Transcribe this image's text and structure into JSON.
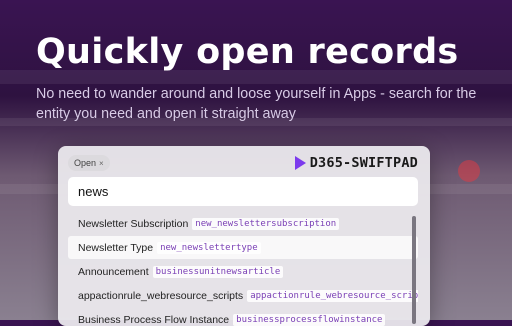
{
  "hero": {
    "title": "Quickly open records",
    "subtitle": "No need to wander around and loose yourself in Apps - search for the entity you need and open it straight away"
  },
  "panel": {
    "mode_chip": "Open",
    "mode_chip_close": "×",
    "brand": "D365-SWIFTPAD",
    "search_value": "news",
    "results": [
      {
        "label": "Newsletter Subscription",
        "code": "new_newslettersubscription",
        "highlighted": false
      },
      {
        "label": "Newsletter Type",
        "code": "new_newslettertype",
        "highlighted": true
      },
      {
        "label": "Announcement",
        "code": "businessunitnewsarticle",
        "highlighted": false
      },
      {
        "label": "appactionrule_webresource_scripts",
        "code": "appactionrule_webresource_scripts",
        "highlighted": false
      },
      {
        "label": "Business Process Flow Instance",
        "code": "businessprocessflowinstance",
        "highlighted": false
      }
    ]
  },
  "colors": {
    "brand_accent": "#7c3aed",
    "code_text": "#7a3fb5"
  }
}
